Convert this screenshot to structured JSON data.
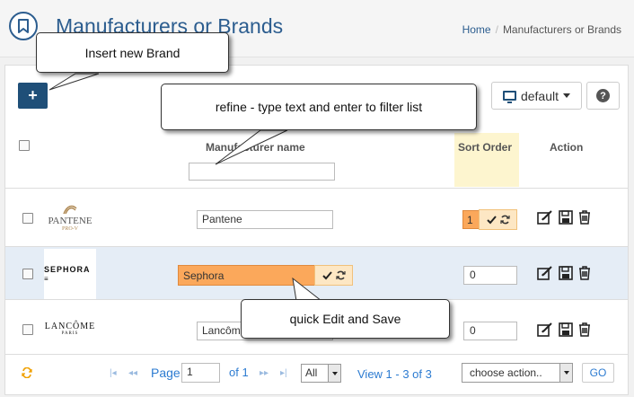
{
  "header": {
    "title": "Manufacturers or Brands",
    "breadcrumb_home": "Home",
    "breadcrumb_sep": "/",
    "breadcrumb_current": "Manufacturers or Brands"
  },
  "toolbar": {
    "add_label": "+",
    "view_label": "default",
    "help_label": "?"
  },
  "table": {
    "columns": {
      "name": "Manufacturer name",
      "sort_order": "Sort Order",
      "action": "Action"
    },
    "filter_value": "",
    "rows": [
      {
        "logo": "PANTENE",
        "logo_sub": "PRO-V",
        "name": "Pantene",
        "sort_order": "1"
      },
      {
        "logo": "SEPHORA",
        "name": "Sephora",
        "sort_order": "0"
      },
      {
        "logo": "LANCÔME",
        "logo_sub": "PARIS",
        "name": "Lancôme",
        "sort_order": "0"
      }
    ]
  },
  "footer": {
    "page_label": "Page",
    "page_value": "1",
    "of_label": "of 1",
    "per_page": "All",
    "view_info": "View 1 - 3 of 3",
    "action_select": "choose action..",
    "go_label": "GO"
  },
  "callouts": {
    "insert": "Insert new Brand",
    "refine": "refine - type text and enter to filter list",
    "quick_edit": "quick Edit and Save"
  },
  "colors": {
    "primary": "#1f4f78",
    "title": "#2c5d8f",
    "highlight_row": "#e5edf6",
    "editing": "#fba85b",
    "sort_header": "#fdf5cf"
  }
}
